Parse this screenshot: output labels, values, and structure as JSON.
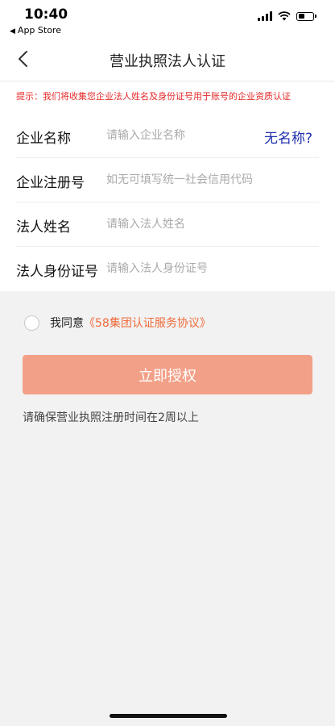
{
  "status_bar": {
    "time": "10:40",
    "back_app": "App Store",
    "icons": [
      "signal-icon",
      "wifi-icon",
      "battery-icon"
    ]
  },
  "navbar": {
    "title": "营业执照法人认证",
    "back_icon": "chevron-left-icon"
  },
  "hint": "提示：我们将收集您企业法人姓名及身份证号用于账号的企业资质认证",
  "form": {
    "fields": [
      {
        "label": "企业名称",
        "placeholder": "请输入企业名称",
        "value": ""
      },
      {
        "label": "企业注册号",
        "placeholder": "如无可填写统一社会信用代码",
        "value": ""
      },
      {
        "label": "法人姓名",
        "placeholder": "请输入法人姓名",
        "value": ""
      },
      {
        "label": "法人身份证号",
        "placeholder": "请输入法人身份证号",
        "value": ""
      }
    ],
    "no_name_link": "无名称?"
  },
  "agreement": {
    "prefix": "我同意",
    "link": "《58集团认证服务协议》",
    "checked": false
  },
  "submit_label": "立即授权",
  "note": "请确保营业执照注册时间在2周以上",
  "colors": {
    "hint_red": "#e52a2a",
    "link_blue": "#1f2fae",
    "agreement_orange": "#f06a3a",
    "button_bg": "#f2a088"
  }
}
